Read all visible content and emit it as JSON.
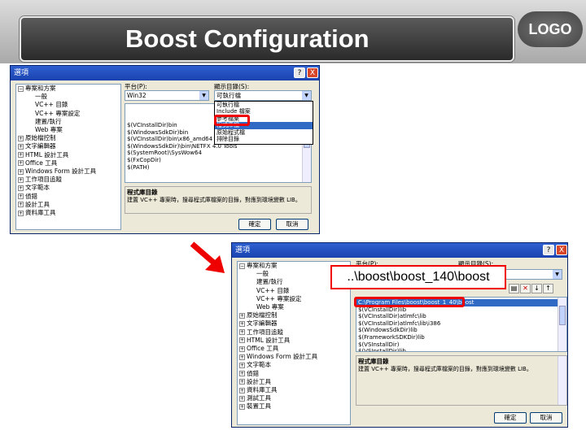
{
  "slide": {
    "title": "Boost Configuration",
    "logo": "LOGO"
  },
  "dialog1": {
    "title": "選項",
    "help": "?",
    "close": "X",
    "tree": [
      {
        "label": "專案和方案",
        "expanded": true
      },
      {
        "label": "一般",
        "child": true
      },
      {
        "label": "VC++ 目錄",
        "child": true
      },
      {
        "label": "VC++ 專案設定",
        "child": true
      },
      {
        "label": "建置/執行",
        "child": true
      },
      {
        "label": "Web 專案",
        "child": true
      },
      {
        "label": "原始檔控制"
      },
      {
        "label": "文字編輯器"
      },
      {
        "label": "HTML 設計工具"
      },
      {
        "label": "Office 工具"
      },
      {
        "label": "Windows Form 設計工具"
      },
      {
        "label": "工作項目追蹤"
      },
      {
        "label": "文字範本"
      },
      {
        "label": "偵錯"
      },
      {
        "label": "設計工具"
      },
      {
        "label": "資料庫工具"
      }
    ],
    "platform_label": "平台(P):",
    "platform_value": "Win32",
    "showdirs_label": "顯示目錄(S):",
    "showdirs_value": "可執行檔",
    "dropdown": [
      "可執行檔",
      "Include 檔案",
      "參考檔案",
      "程式庫檔",
      "原始程式檔",
      "排除目錄"
    ],
    "list": [
      "$(VCInstallDir)bin",
      "$(WindowsSdkDir)bin",
      "$(VCInstallDir)bin\\x86_amd64",
      "$(WindowsSdkDir)\\bin\\NETFX 4.0 Tools",
      "$(SystemRoot)\\SysWow64",
      "$(FxCopDir)",
      "$(PATH)"
    ],
    "desc_title": "程式庫目錄",
    "desc_text": "建置 VC++ 專案時，搜尋程式庫檔案的目錄，對應到環境變數 LIB。",
    "ok": "確定",
    "cancel": "取消"
  },
  "dialog2": {
    "title": "選項",
    "help": "?",
    "close": "X",
    "tree": [
      {
        "label": "專案和方案",
        "expanded": true
      },
      {
        "label": "一般",
        "child": true
      },
      {
        "label": "建置/執行",
        "child": true
      },
      {
        "label": "VC++ 目錄",
        "child": true
      },
      {
        "label": "VC++ 專案設定",
        "child": true
      },
      {
        "label": "Web 專案",
        "child": true
      },
      {
        "label": "原始檔控制"
      },
      {
        "label": "文字編輯器"
      },
      {
        "label": "工作項目追蹤"
      },
      {
        "label": "HTML 設計工具"
      },
      {
        "label": "Office 工具"
      },
      {
        "label": "Windows Form 設計工具"
      },
      {
        "label": "文字範本"
      },
      {
        "label": "偵錯"
      },
      {
        "label": "設計工具"
      },
      {
        "label": "資料庫工具"
      },
      {
        "label": "測試工具"
      },
      {
        "label": "裝置工具"
      }
    ],
    "platform_label": "平台(P):",
    "showdirs_label": "顯示目錄(S):",
    "list": [
      "C:\\Program Files\\boost\\boost_1_40\\boost",
      "$(VCInstallDir)lib",
      "$(VCInstallDir)atlmfc\\lib",
      "$(VCInstallDir)atlmfc\\lib\\i386",
      "$(WindowsSdkDir)lib",
      "$(FrameworkSDKDir)lib",
      "$(VSInstallDir)",
      "$(VSInstallDir)lib"
    ],
    "desc_title": "程式庫目錄",
    "desc_text": "建置 VC++ 專案時，搜尋程式庫檔案的目錄，對應到環境變數 LIB。",
    "ok": "確定",
    "cancel": "取消"
  },
  "callout": "..\\boost\\boost_140\\boost"
}
